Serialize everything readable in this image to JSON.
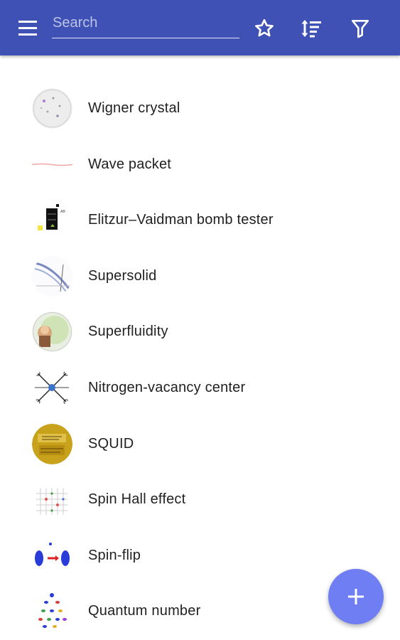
{
  "appbar": {
    "search_placeholder": "Search",
    "icons": [
      "menu-icon",
      "star-icon",
      "sort-icon",
      "filter-icon"
    ],
    "color": "#3f51b5"
  },
  "items": [
    {
      "label": "Wigner crystal",
      "thumb": "wigner-crystal-thumbnail"
    },
    {
      "label": "Wave packet",
      "thumb": "wave-packet-thumbnail"
    },
    {
      "label": "Elitzur–Vaidman bomb tester",
      "thumb": "bomb-tester-thumbnail"
    },
    {
      "label": "Supersolid",
      "thumb": "supersolid-thumbnail"
    },
    {
      "label": "Superfluidity",
      "thumb": "superfluidity-thumbnail"
    },
    {
      "label": "Nitrogen-vacancy center",
      "thumb": "nv-center-thumbnail"
    },
    {
      "label": "SQUID",
      "thumb": "squid-thumbnail"
    },
    {
      "label": "Spin Hall effect",
      "thumb": "spin-hall-thumbnail"
    },
    {
      "label": "Spin-flip",
      "thumb": "spin-flip-thumbnail"
    },
    {
      "label": "Quantum number",
      "thumb": "quantum-number-thumbnail"
    }
  ],
  "fab": {
    "icon": "add-icon",
    "color": "#6f7ef2"
  }
}
